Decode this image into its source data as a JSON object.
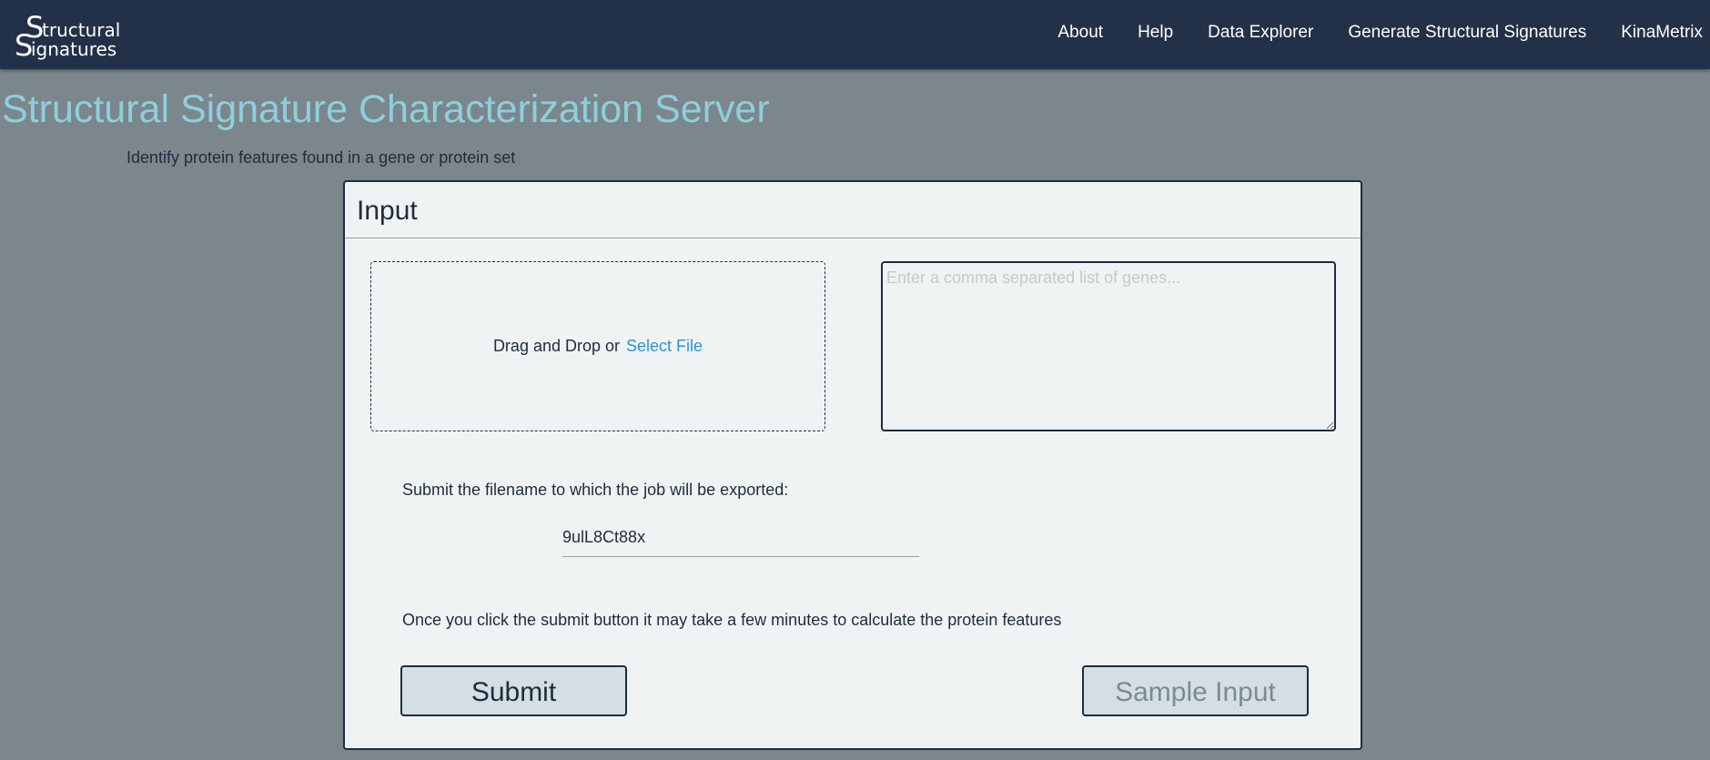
{
  "logo": {
    "row1_initial": "S",
    "row1_rest": "tructural",
    "row2_initial": "S",
    "row2_rest": "ignatures"
  },
  "nav": {
    "items": [
      {
        "label": "About"
      },
      {
        "label": "Help"
      },
      {
        "label": "Data Explorer"
      },
      {
        "label": "Generate Structural Signatures"
      },
      {
        "label": "KinaMetrix"
      }
    ]
  },
  "page": {
    "title": "Structural Signature Characterization Server",
    "subtitle": "Identify protein features found in a gene or protein set"
  },
  "input_card": {
    "title": "Input",
    "dropzone_text": "Drag and Drop or",
    "dropzone_link": "Select File",
    "genes_placeholder": "Enter a comma separated list of genes...",
    "genes_value": "",
    "filename_label": "Submit the filename to which the job will be exported:",
    "filename_value": "9ulL8Ct88x",
    "info_text": "Once you click the submit button it may take a few minutes to calculate the protein features",
    "submit_label": "Submit",
    "sample_label": "Sample Input"
  },
  "colors": {
    "navbar": "#223148",
    "background": "#7b878c",
    "title": "#8ecfdc",
    "card": "#eff3f4",
    "link": "#2c94d8",
    "button": "#d3dfe2"
  }
}
